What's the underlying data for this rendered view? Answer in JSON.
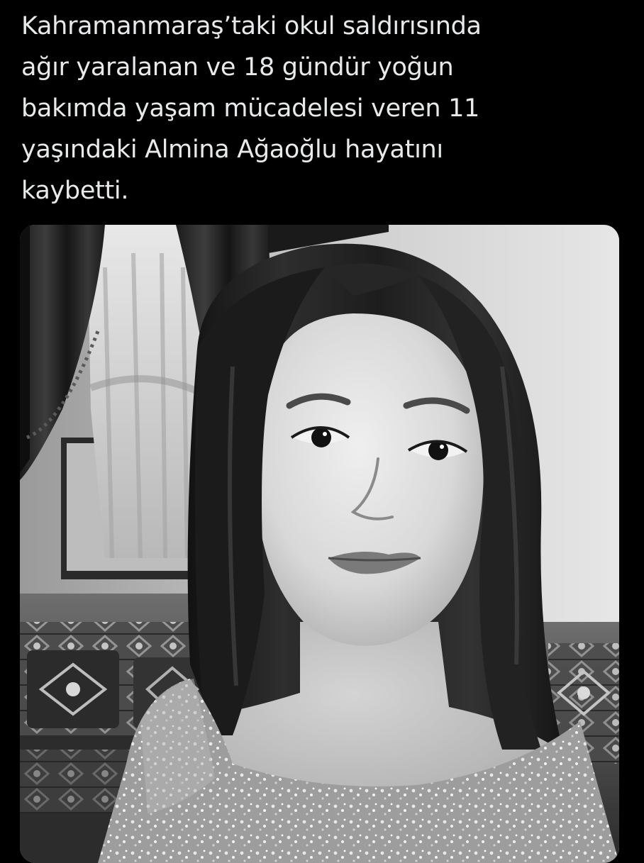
{
  "tweet": {
    "text_lines": [
      "Kahramanmaraş’taki okul saldırısında",
      "ağır yaralanan ve 18 gündür yoğun",
      "bakımda yaşam mücadelesi veren 11",
      "yaşındaki Almina Ağaoğlu hayatını",
      "kaybetti."
    ]
  },
  "media": {
    "icon": "photo-icon",
    "style": "black-and-white portrait photograph"
  },
  "colors": {
    "background": "#000000",
    "text": "#e7e9ea"
  }
}
